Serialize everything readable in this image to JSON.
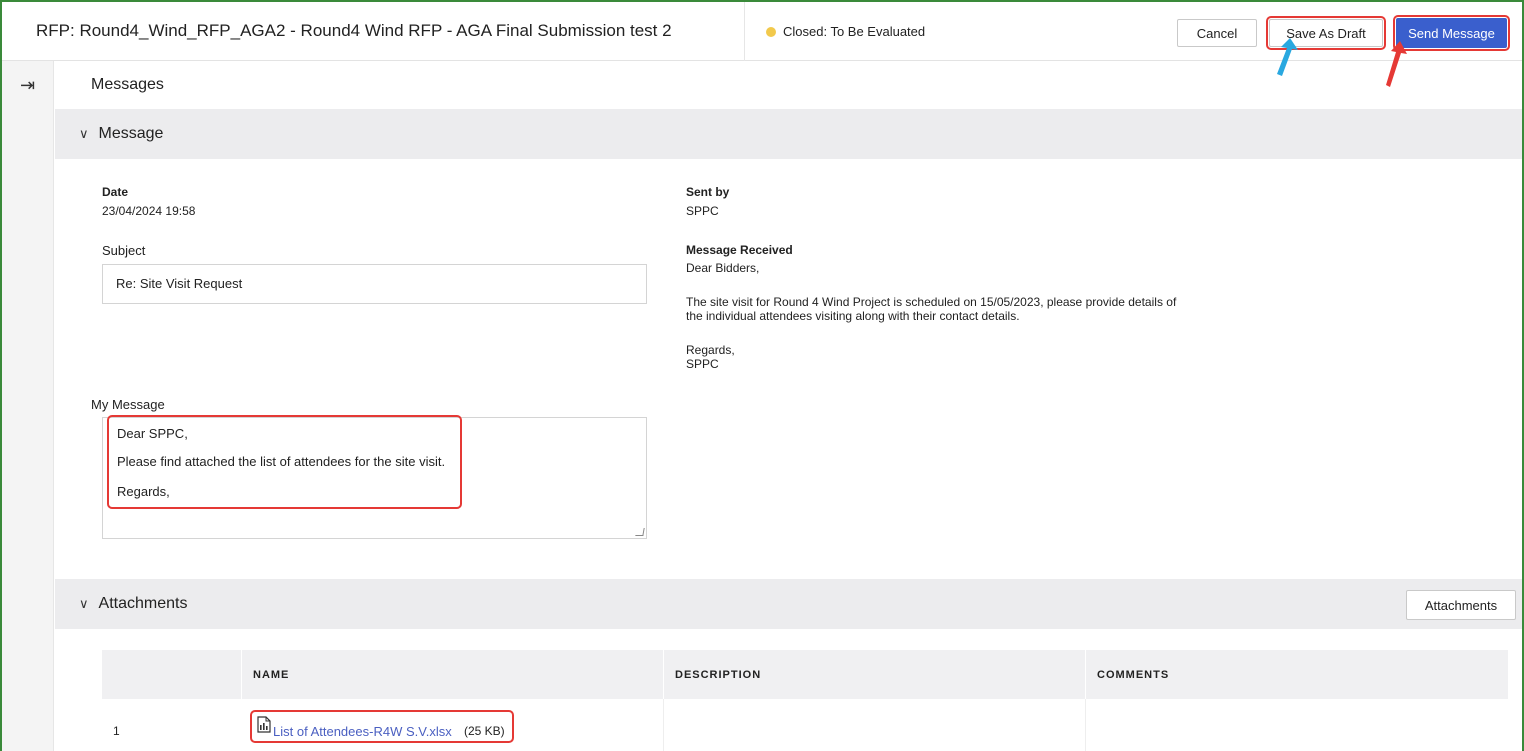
{
  "header": {
    "title": "RFP: Round4_Wind_RFP_AGA2 - Round4 Wind RFP - AGA Final Submission test 2",
    "status": "Closed: To Be Evaluated",
    "cancel_label": "Cancel",
    "draft_label": "Save As Draft",
    "send_label": "Send Message"
  },
  "rail": {
    "icon": "expand-panel-icon"
  },
  "page": {
    "title": "Messages"
  },
  "message_section": {
    "label": "Message",
    "date_label": "Date",
    "date_value": "23/04/2024 19:58",
    "subject_label": "Subject",
    "subject_value": "Re: Site Visit Request",
    "sent_by_label": "Sent by",
    "sent_by_value": "SPPC",
    "received_label": "Message Received",
    "received_lines": [
      "Dear Bidders,",
      "The site visit for Round 4 Wind Project is scheduled on 15/05/2023, please provide details of",
      "the individual attendees visiting along with their contact details.",
      "Regards,",
      "SPPC"
    ],
    "my_message_label": "My Message",
    "my_message_lines": [
      "Dear SPPC,",
      "Please find attached the list of attendees for the site visit.",
      "Regards,"
    ]
  },
  "attachments_section": {
    "label": "Attachments",
    "button_label": "Attachments",
    "columns": [
      "NAME",
      "DESCRIPTION",
      "COMMENTS"
    ],
    "rows": [
      {
        "num": "1",
        "name": "List of Attendees-R4W S.V.xlsx",
        "size": "(25 KB)",
        "description": "",
        "comments": ""
      }
    ]
  },
  "colors": {
    "primary": "#3a5fcd",
    "highlight": "#e53935",
    "status_dot": "#f2c94c",
    "link": "#4a5fc1",
    "frame": "#3a8a3a",
    "arrow_blue": "#29a8e0",
    "arrow_red": "#e53935"
  }
}
